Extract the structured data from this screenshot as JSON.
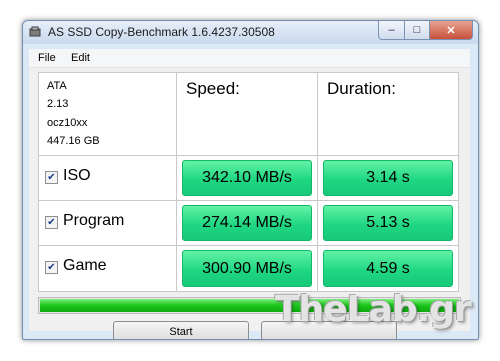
{
  "window": {
    "title": "AS SSD Copy-Benchmark 1.6.4237.30508",
    "minimize_glyph": "–",
    "maximize_glyph": "□",
    "close_glyph": "✕"
  },
  "menu": {
    "file": "File",
    "edit": "Edit"
  },
  "device": {
    "type": "ATA",
    "firmware": "2.13",
    "name": "ocz10xx",
    "capacity": "447.16 GB"
  },
  "headers": {
    "speed": "Speed:",
    "duration": "Duration:"
  },
  "rows": [
    {
      "label": "ISO",
      "checked": true,
      "speed": "342.10 MB/s",
      "duration": "3.14 s"
    },
    {
      "label": "Program",
      "checked": true,
      "speed": "274.14 MB/s",
      "duration": "5.13 s"
    },
    {
      "label": "Game",
      "checked": true,
      "speed": "300.90 MB/s",
      "duration": "4.59 s"
    }
  ],
  "progress": {
    "value": 1.0
  },
  "buttons": {
    "start": "Start",
    "second": ""
  },
  "check_glyph": "✔",
  "watermark": "TheLab.gr",
  "colors": {
    "result_green": "#1fd782",
    "progress_green": "#1bc41b"
  }
}
